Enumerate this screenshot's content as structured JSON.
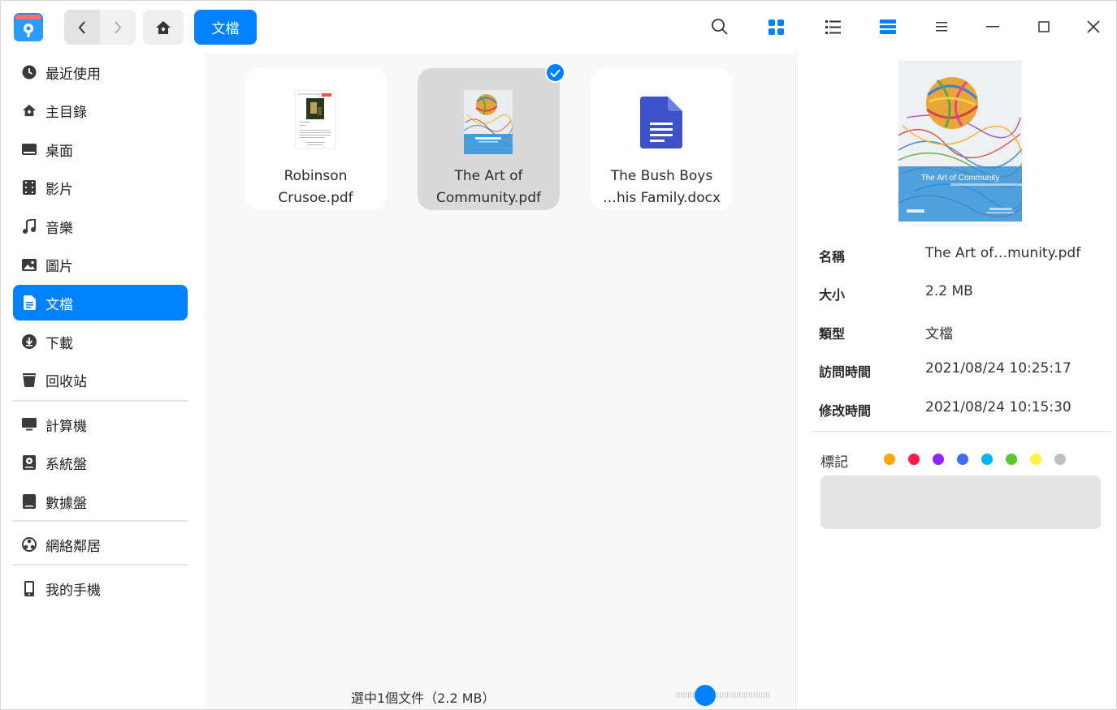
{
  "toolbar": {
    "breadcrumb": "文檔",
    "icons": [
      "search-icon",
      "icon-view-icon",
      "list-view-icon",
      "detail-view-icon",
      "menu-icon",
      "minimize-icon",
      "maximize-icon",
      "close-icon"
    ]
  },
  "sidebar": {
    "items": [
      {
        "label": "最近使用",
        "icon": "clock-icon"
      },
      {
        "label": "主目錄",
        "icon": "home-icon"
      },
      {
        "label": "桌面",
        "icon": "desktop-icon"
      },
      {
        "label": "影片",
        "icon": "video-icon"
      },
      {
        "label": "音樂",
        "icon": "music-icon"
      },
      {
        "label": "圖片",
        "icon": "picture-icon"
      },
      {
        "label": "文檔",
        "icon": "document-icon",
        "active": true
      },
      {
        "label": "下載",
        "icon": "download-icon"
      },
      {
        "label": "回收站",
        "icon": "trash-icon"
      },
      {
        "label": "計算機",
        "icon": "computer-icon"
      },
      {
        "label": "系統盤",
        "icon": "system-disk-icon"
      },
      {
        "label": "數據盤",
        "icon": "data-disk-icon"
      },
      {
        "label": "網絡鄰居",
        "icon": "network-icon"
      },
      {
        "label": "我的手機",
        "icon": "phone-icon"
      }
    ]
  },
  "files": [
    {
      "name_line1": "Robinson",
      "name_line2": "Crusoe.pdf",
      "selected": false
    },
    {
      "name_line1": "The Art of",
      "name_line2": "Community.pdf",
      "selected": true
    },
    {
      "name_line1": "The Bush Boys",
      "name_line2": "…his Family.docx",
      "selected": false
    }
  ],
  "status": {
    "text": "選中1個文件（2.2 MB）",
    "zoom_level": 0.25
  },
  "detail": {
    "preview_title": "The Art of Community",
    "props": [
      {
        "label": "名稱",
        "value": "The Art of…munity.pdf"
      },
      {
        "label": "大小",
        "value": "2.2 MB"
      },
      {
        "label": "類型",
        "value": "文檔"
      },
      {
        "label": "訪問時間",
        "value": "2021/08/24 10:25:17"
      },
      {
        "label": "修改時間",
        "value": "2021/08/24 10:15:30"
      }
    ],
    "tag_label": "標記",
    "tag_colors": [
      "#ffa503",
      "#ff1c49",
      "#9023fc",
      "#3d6ef0",
      "#00b7f5",
      "#5bc92d",
      "#fef144",
      "#c0c0c0"
    ]
  }
}
